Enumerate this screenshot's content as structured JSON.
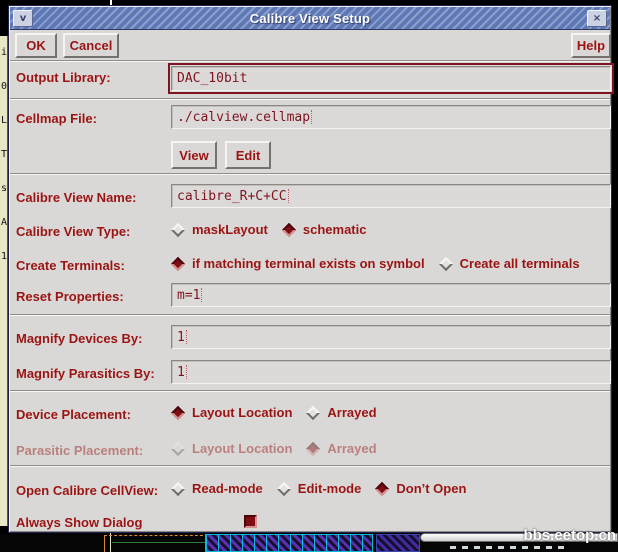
{
  "window": {
    "title": "Calibre View Setup",
    "menu_icon": "v",
    "close_icon": "×"
  },
  "toolbar": {
    "ok": "OK",
    "cancel": "Cancel",
    "help": "Help"
  },
  "fields": {
    "output_library": {
      "label": "Output Library:",
      "value": "DAC_10bit"
    },
    "cellmap_file": {
      "label": "Cellmap File:",
      "value": "./calview.cellmap",
      "view_button": "View",
      "edit_button": "Edit"
    },
    "view_name": {
      "label": "Calibre View Name:",
      "value": "calibre_R+C+CC"
    },
    "view_type": {
      "label": "Calibre View Type:",
      "options": [
        {
          "label": "maskLayout",
          "selected": false
        },
        {
          "label": "schematic",
          "selected": true
        }
      ]
    },
    "create_terminals": {
      "label": "Create Terminals:",
      "options": [
        {
          "label": "if matching terminal exists on symbol",
          "selected": true
        },
        {
          "label": "Create all terminals",
          "selected": false
        }
      ]
    },
    "reset_properties": {
      "label": "Reset Properties:",
      "value": "m=1"
    },
    "magnify_devices": {
      "label": "Magnify Devices By:",
      "value": "1"
    },
    "magnify_parasitics": {
      "label": "Magnify Parasitics By:",
      "value": "1"
    },
    "device_placement": {
      "label": "Device Placement:",
      "options": [
        {
          "label": "Layout Location",
          "selected": true
        },
        {
          "label": "Arrayed",
          "selected": false
        }
      ]
    },
    "parasitic_placement": {
      "label": "Parasitic Placement:",
      "disabled": true,
      "options": [
        {
          "label": "Layout Location",
          "selected": false
        },
        {
          "label": "Arrayed",
          "selected": true
        }
      ]
    },
    "open_cellview": {
      "label": "Open Calibre CellView:",
      "options": [
        {
          "label": "Read-mode",
          "selected": false
        },
        {
          "label": "Edit-mode",
          "selected": false
        },
        {
          "label": "Don’t Open",
          "selected": true
        }
      ]
    },
    "always_show": {
      "label": "Always Show Dialog",
      "checked": true
    }
  },
  "background": {
    "left_strip_chars": "i 0 L T s A 1",
    "watermark": "bbs.eetop.cn"
  },
  "colors": {
    "accent": "#9a1414",
    "titlebar": "#5d78b5",
    "selected": "#7e0e14",
    "dialog_bg": "#dad8d6"
  }
}
